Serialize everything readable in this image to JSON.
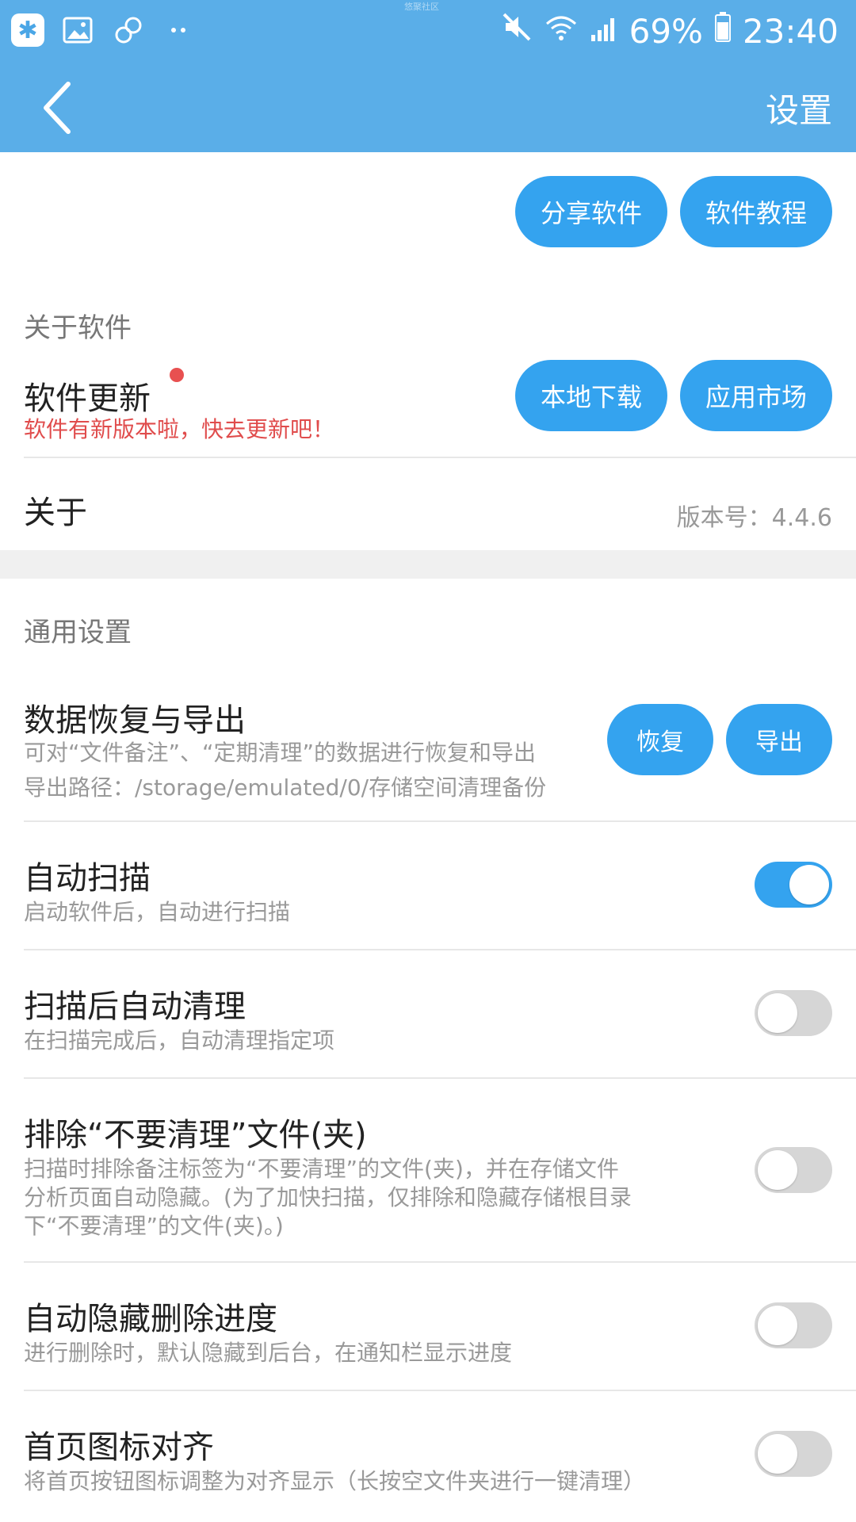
{
  "status": {
    "battery": "69%",
    "time": "23:40",
    "center_tiny": "悠聚社区"
  },
  "header": {
    "title": "设置"
  },
  "top_actions": {
    "share": "分享软件",
    "tutorial": "软件教程"
  },
  "about_section": {
    "title": "关于软件",
    "update": {
      "title": "软件更新",
      "desc": "软件有新版本啦，快去更新吧！",
      "local": "本地下载",
      "market": "应用市场"
    },
    "about": {
      "title": "关于",
      "version": "版本号：4.4.6"
    }
  },
  "general_section": {
    "title": "通用设置",
    "data": {
      "title": "数据恢复与导出",
      "desc1": "可对“文件备注”、“定期清理”的数据进行恢复和导出",
      "desc2": "导出路径：/storage/emulated/0/存储空间清理备份",
      "restore": "恢复",
      "export": "导出"
    },
    "auto_scan": {
      "title": "自动扫描",
      "desc": "启动软件后，自动进行扫描",
      "on": true
    },
    "auto_clean": {
      "title": "扫描后自动清理",
      "desc": "在扫描完成后，自动清理指定项",
      "on": false
    },
    "exclude": {
      "title": "排除“不要清理”文件(夹)",
      "desc1": "扫描时排除备注标签为“不要清理”的文件(夹)，并在存储文件",
      "desc2": "分析页面自动隐藏。(为了加快扫描，仅排除和隐藏存储根目录",
      "desc3": "下“不要清理”的文件(夹)。)",
      "on": false
    },
    "hide_progress": {
      "title": "自动隐藏删除进度",
      "desc": "进行删除时，默认隐藏到后台，在通知栏显示进度",
      "on": false
    },
    "icon_align": {
      "title": "首页图标对齐",
      "desc": "将首页按钮图标调整为对齐显示（长按空文件夹进行一键清理）",
      "on": false
    }
  }
}
